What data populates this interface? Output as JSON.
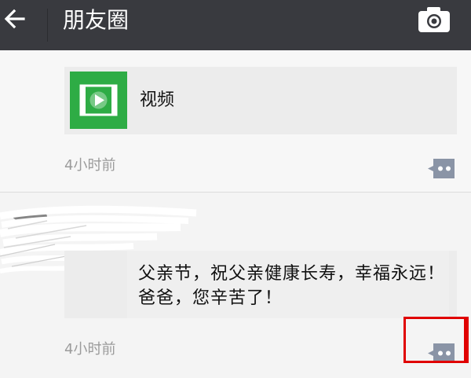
{
  "header": {
    "title": "朋友圈",
    "back_icon": "arrow-left-icon",
    "camera_icon": "camera-icon"
  },
  "posts": [
    {
      "share_label": "视频",
      "share_icon": "video-film-icon",
      "time": "4小时前",
      "comment_icon": "comment-dots-icon"
    },
    {
      "text": "父亲节，祝父亲健康长寿，幸福永远！爸爸，您辛苦了！",
      "time": "4小时前",
      "comment_icon": "comment-dots-icon"
    }
  ],
  "colors": {
    "header_bg": "#393a3f",
    "video_green": "#2eac45",
    "comment_button": "#8a94a6",
    "highlight": "#e00000"
  }
}
